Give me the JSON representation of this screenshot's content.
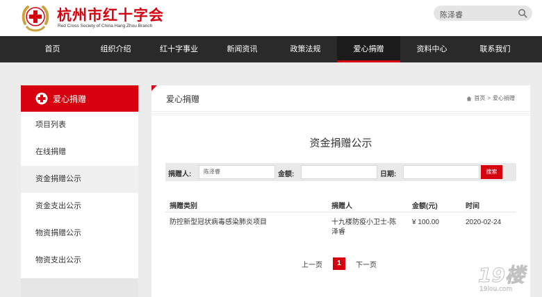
{
  "brand": {
    "name_cn": "杭州市红十字会",
    "name_en": "Red Cross Society of China Hang Zhou Branch"
  },
  "search": {
    "value": "陈泽睿"
  },
  "nav": {
    "items": [
      {
        "label": "首页"
      },
      {
        "label": "组织介绍"
      },
      {
        "label": "红十字事业"
      },
      {
        "label": "新闻资讯"
      },
      {
        "label": "政策法规"
      },
      {
        "label": "爱心捐赠"
      },
      {
        "label": "资料中心"
      },
      {
        "label": "联系我们"
      }
    ],
    "active_index": 5
  },
  "sidebar": {
    "header": "爱心捐赠",
    "items": [
      {
        "label": "项目列表"
      },
      {
        "label": "在线捐赠"
      },
      {
        "label": "资金捐赠公示"
      },
      {
        "label": "资金支出公示"
      },
      {
        "label": "物资捐赠公示"
      },
      {
        "label": "物资支出公示"
      }
    ],
    "active_index": 2
  },
  "main": {
    "section_title": "爱心捐赠",
    "breadcrumb": {
      "home": "首页",
      "sep": ">",
      "current": "爱心捐赠"
    },
    "page_title": "资金捐赠公示",
    "filter": {
      "donor_label": "捐赠人:",
      "donor_value": "陈泽睿",
      "amount_label": "金额:",
      "amount_value": "",
      "date_label": "日期:",
      "date_value": "",
      "search_button": "搜索"
    },
    "table": {
      "headers": [
        "捐赠类别",
        "捐赠人",
        "金额(元)",
        "时间"
      ],
      "rows": [
        {
          "category": "防控新型冠状病毒感染肺炎项目",
          "donor_line1": "十九楼防疫小卫士-陈",
          "donor_line2": "泽睿",
          "amount": "¥ 100.00",
          "date": "2020-02-24"
        }
      ]
    },
    "pager": {
      "prev": "上一页",
      "current": "1",
      "next": "下一页"
    }
  },
  "watermark": {
    "text": "19楼",
    "sub": "19lou.com"
  },
  "colors": {
    "accent": "#d7000f",
    "nav_bg": "#2a2a2a",
    "page_bg": "#ececec"
  }
}
